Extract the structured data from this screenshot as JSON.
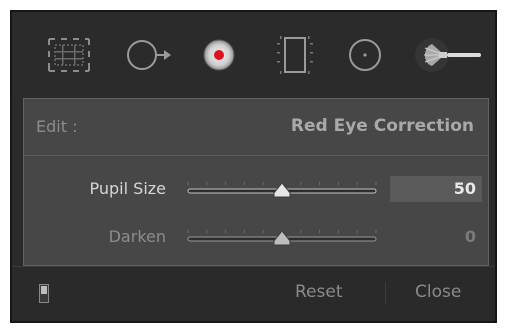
{
  "toolbar": {
    "tools": [
      {
        "name": "crop-overlay-tool",
        "icon": "crop-grid-icon",
        "active": false
      },
      {
        "name": "spot-removal-tool",
        "icon": "spot-removal-icon",
        "active": false
      },
      {
        "name": "red-eye-tool",
        "icon": "red-eye-icon",
        "active": true
      },
      {
        "name": "graduated-filter-tool",
        "icon": "graduated-filter-icon",
        "active": false
      },
      {
        "name": "radial-filter-tool",
        "icon": "radial-filter-icon",
        "active": false
      },
      {
        "name": "adjustment-brush-tool",
        "icon": "brush-icon",
        "active": false
      }
    ]
  },
  "edit": {
    "label": "Edit :",
    "tool_title": "Red Eye Correction"
  },
  "sliders": [
    {
      "label": "Pupil Size",
      "value": "50",
      "fraction": 0.5,
      "enabled": true
    },
    {
      "label": "Darken",
      "value": "0",
      "fraction": 0.5,
      "enabled": false
    }
  ],
  "footer": {
    "reset_label": "Reset",
    "close_label": "Close"
  },
  "colors": {
    "panel": "#2a2a2a",
    "options_bg": "#474747",
    "accent_red": "#e01020"
  }
}
